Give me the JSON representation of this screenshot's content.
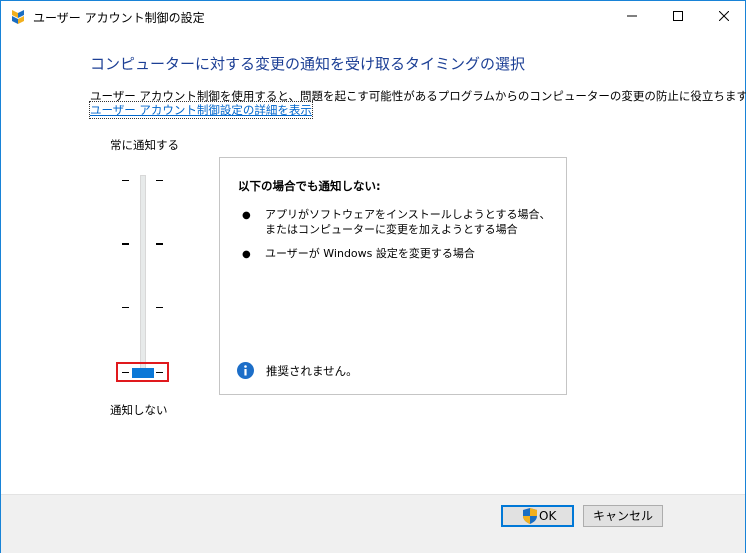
{
  "window": {
    "title": "ユーザー アカウント制御の設定",
    "accent": "#1883d7"
  },
  "heading": "コンピューターに対する変更の通知を受け取るタイミングの選択",
  "description": "ユーザー アカウント制御を使用すると、問題を起こす可能性があるプログラムからのコンピューターの変更の防止に役立ちます。",
  "link": "ユーザー アカウント制御設定の詳細を表示",
  "slider": {
    "top_label": "常に通知する",
    "bottom_label": "通知しない",
    "levels": 4,
    "selected_level": 1,
    "thumb_color": "#0a78d7",
    "focus_color": "#e0191d"
  },
  "panel": {
    "title": "以下の場合でも通知しない:",
    "bullets": [
      "アプリがソフトウェアをインストールしようとする場合、またはコンピューターに変更を加えようとする場合",
      "ユーザーが Windows 設定を変更する場合"
    ],
    "note": "推奨されません。",
    "note_icon": "info-icon"
  },
  "buttons": {
    "ok": "OK",
    "cancel": "キャンセル",
    "ok_icon": "uac-shield-icon"
  }
}
